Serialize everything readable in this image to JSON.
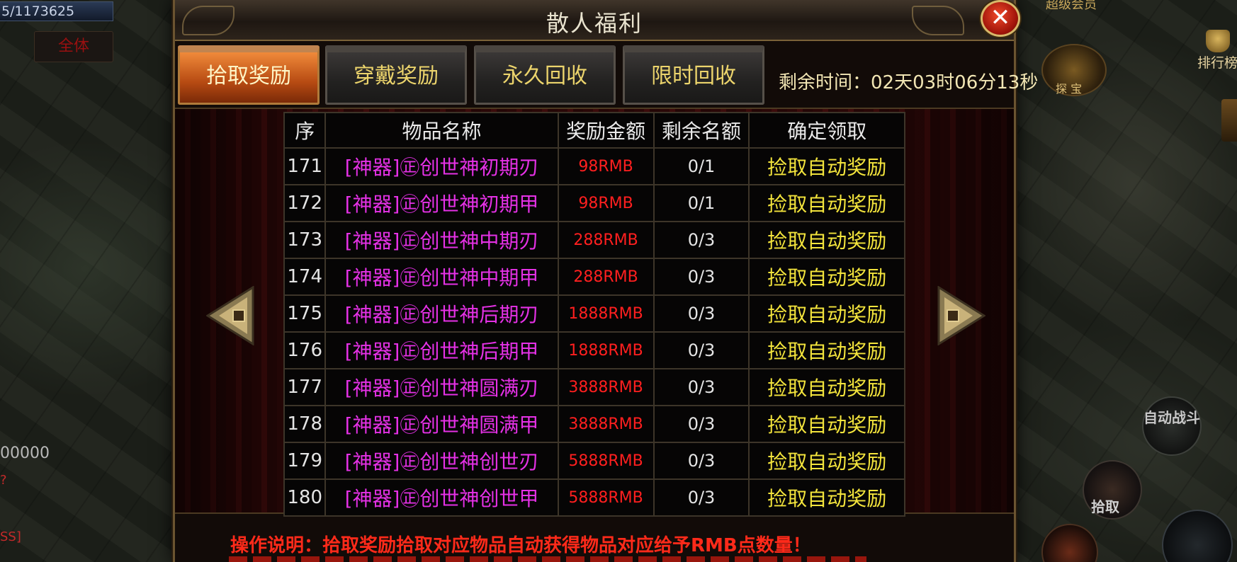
{
  "hud": {
    "hp_text": "5/1173625",
    "chat_tab": "全体",
    "left_number": "00000",
    "vip_text": "超级会员",
    "rank_label": "排行榜",
    "treasure_label": "探 宝",
    "auto_fight": "自动战斗",
    "pickup": "拾取"
  },
  "panel": {
    "title": "散人福利",
    "close_icon": "✕",
    "tabs": [
      {
        "label": "拾取奖励",
        "active": true
      },
      {
        "label": "穿戴奖励",
        "active": false
      },
      {
        "label": "永久回收",
        "active": false
      },
      {
        "label": "限时回收",
        "active": false
      }
    ],
    "remaining_time": "剩余时间：02天03时06分13秒",
    "columns": [
      "序",
      "物品名称",
      "奖励金额",
      "剩余名额",
      "确定领取"
    ],
    "rows": [
      {
        "idx": "171",
        "name": "[神器]㊣创世神初期刃",
        "amount": "98RMB",
        "quota": "0/1",
        "action": "捡取自动奖励"
      },
      {
        "idx": "172",
        "name": "[神器]㊣创世神初期甲",
        "amount": "98RMB",
        "quota": "0/1",
        "action": "捡取自动奖励"
      },
      {
        "idx": "173",
        "name": "[神器]㊣创世神中期刃",
        "amount": "288RMB",
        "quota": "0/3",
        "action": "捡取自动奖励"
      },
      {
        "idx": "174",
        "name": "[神器]㊣创世神中期甲",
        "amount": "288RMB",
        "quota": "0/3",
        "action": "捡取自动奖励"
      },
      {
        "idx": "175",
        "name": "[神器]㊣创世神后期刃",
        "amount": "1888RMB",
        "quota": "0/3",
        "action": "捡取自动奖励"
      },
      {
        "idx": "176",
        "name": "[神器]㊣创世神后期甲",
        "amount": "1888RMB",
        "quota": "0/3",
        "action": "捡取自动奖励"
      },
      {
        "idx": "177",
        "name": "[神器]㊣创世神圆满刃",
        "amount": "3888RMB",
        "quota": "0/3",
        "action": "捡取自动奖励"
      },
      {
        "idx": "178",
        "name": "[神器]㊣创世神圆满甲",
        "amount": "3888RMB",
        "quota": "0/3",
        "action": "捡取自动奖励"
      },
      {
        "idx": "179",
        "name": "[神器]㊣创世神创世刃",
        "amount": "5888RMB",
        "quota": "0/3",
        "action": "捡取自动奖励"
      },
      {
        "idx": "180",
        "name": "[神器]㊣创世神创世甲",
        "amount": "5888RMB",
        "quota": "0/3",
        "action": "捡取自动奖励"
      }
    ],
    "note": "操作说明：拾取奖励拾取对应物品自动获得物品对应给予RMB点数量！"
  },
  "colors": {
    "item_name": "#e531e6",
    "amount": "#ff1f1f",
    "action": "#f3e43c",
    "tab_active": "#b64a12"
  },
  "icons": {
    "close": "close-icon",
    "prev": "arrow-left-icon",
    "next": "arrow-right-icon"
  }
}
